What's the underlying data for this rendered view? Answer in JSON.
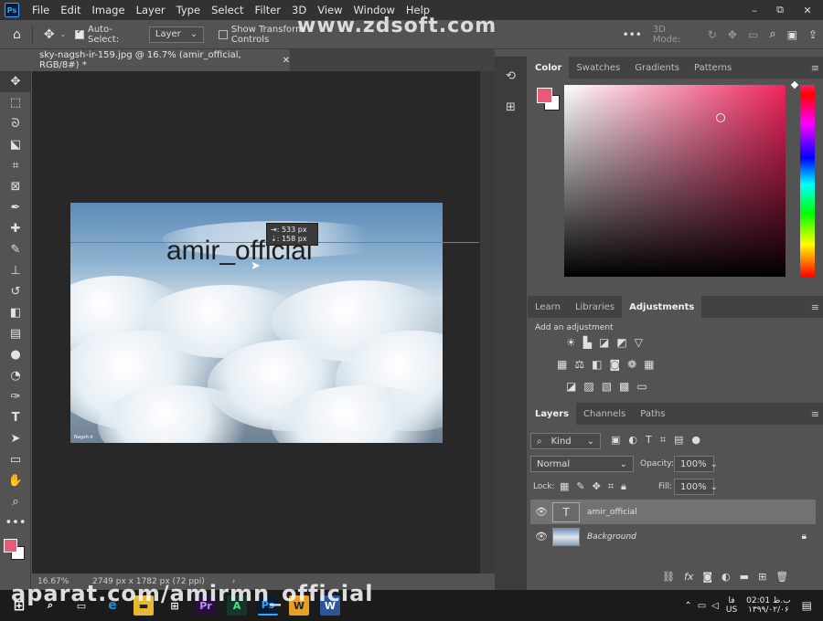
{
  "app": {
    "logo": "Ps",
    "menu": [
      "File",
      "Edit",
      "Image",
      "Layer",
      "Type",
      "Select",
      "Filter",
      "3D",
      "View",
      "Window",
      "Help"
    ]
  },
  "window_controls": {
    "minimize": "–",
    "restore": "⧉",
    "close": "✕"
  },
  "watermark_top": "www.zdsoft.com",
  "watermark_bottom": "aparat.com/amirmn_official",
  "options": {
    "auto_select_label": "Auto-Select:",
    "auto_select_checked": true,
    "target": "Layer",
    "show_transform_label": "Show Transform Controls",
    "mode_label": "3D Mode:"
  },
  "document": {
    "tab_title": "sky-nagsh-ir-159.jpg @ 16.7% (amir_official, RGB/8#) *",
    "text_layer": "amir_official",
    "image_credit": "Nagsh-ir",
    "zoom": "16.67%",
    "dimensions": "2749 px x 1782 px (72 ppi)"
  },
  "tooltip": {
    "dx": "533 px",
    "dy": "158 px"
  },
  "color_panel": {
    "tabs": [
      "Color",
      "Swatches",
      "Gradients",
      "Patterns"
    ],
    "active": "Color",
    "foreground": "#e85a76",
    "background": "#ffffff",
    "hue_color": "#f0245e"
  },
  "adjust_panel": {
    "tabs": [
      "Learn",
      "Libraries",
      "Adjustments"
    ],
    "active": "Adjustments",
    "hint": "Add an adjustment"
  },
  "layers_panel": {
    "tabs": [
      "Layers",
      "Channels",
      "Paths"
    ],
    "active": "Layers",
    "filter_kind": "Kind",
    "blend_mode": "Normal",
    "opacity_label": "Opacity:",
    "opacity": "100%",
    "lock_label": "Lock:",
    "fill_label": "Fill:",
    "fill": "100%",
    "layers": [
      {
        "name": "amir_official",
        "type": "text",
        "selected": true
      },
      {
        "name": "Background",
        "type": "image",
        "selected": false,
        "locked": true
      }
    ]
  },
  "taskbar": {
    "time": "02:01 ب.ظ",
    "date": "۱۳۹۹/۰۲/۰۶",
    "lang": "فا",
    "region": "US"
  }
}
